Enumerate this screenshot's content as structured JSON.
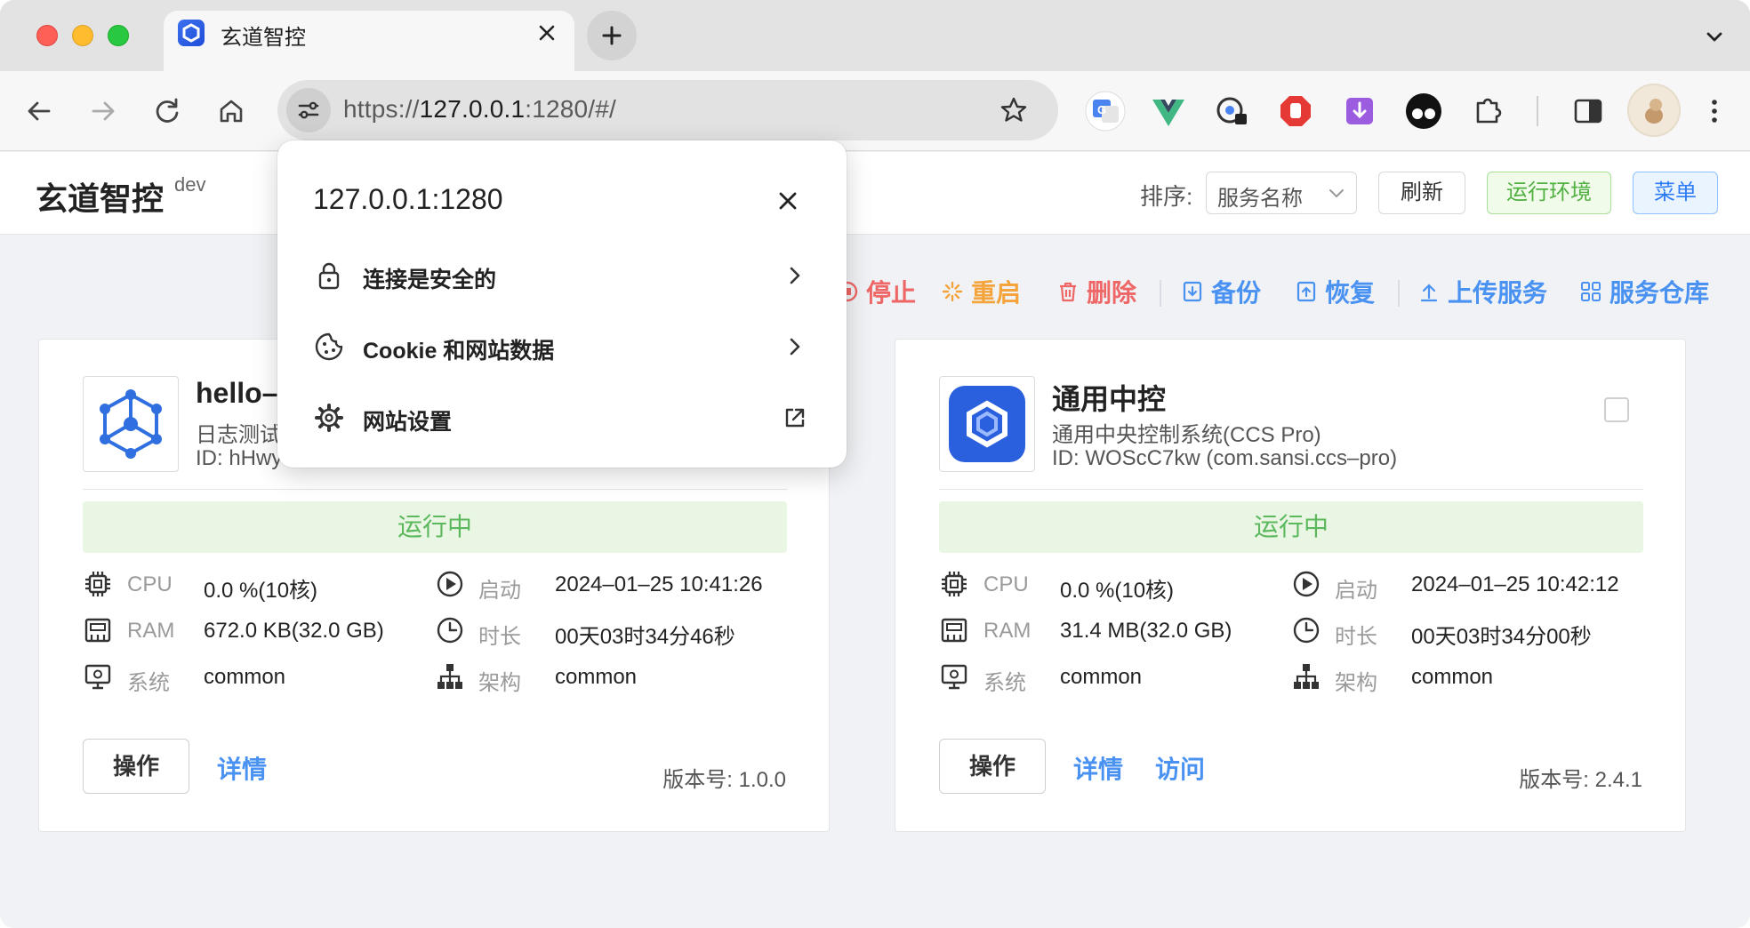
{
  "tab": {
    "title": "玄道智控"
  },
  "omnibox": {
    "url_scheme": "https://",
    "url_host": "127.0.0.1",
    "url_rest": ":1280/#/"
  },
  "popup": {
    "title": "127.0.0.1:1280",
    "items": [
      {
        "label": "连接是安全的",
        "icon": "lock-icon"
      },
      {
        "label": "Cookie 和网站数据",
        "icon": "cookie-icon"
      },
      {
        "label": "网站设置",
        "icon": "gear-icon"
      }
    ]
  },
  "header": {
    "title": "玄道智控",
    "env": "dev",
    "sort_label": "排序:",
    "sort_value": "服务名称",
    "refresh": "刷新",
    "run_env": "运行环境",
    "menu": "菜单"
  },
  "actions": {
    "stop": "停止",
    "restart": "重启",
    "delete": "删除",
    "backup": "备份",
    "restore": "恢复",
    "upload": "上传服务",
    "repo": "服务仓库"
  },
  "colors": {
    "danger": "#ee6666",
    "warning": "#f4a43b",
    "primary": "#4a92f2",
    "success": "#5cb85c"
  },
  "labels": {
    "cpu": "CPU",
    "ram": "RAM",
    "system": "系统",
    "start": "启动",
    "duration": "时长",
    "arch": "架构",
    "operate": "操作",
    "detail": "详情",
    "visit": "访问"
  },
  "services": [
    {
      "name": "hello–",
      "desc": "日志测试",
      "id": "ID: hHwy",
      "status": "运行中",
      "cpu": "0.0 %(10核)",
      "ram": "672.0 KB(32.0 GB)",
      "system": "common",
      "start": "2024–01–25 10:41:26",
      "duration": "00天03时34分46秒",
      "arch": "common",
      "version": "版本号: 1.0.0"
    },
    {
      "name": "通用中控",
      "desc": "通用中央控制系统(CCS Pro)",
      "id": "ID: WOScC7kw (com.sansi.ccs–pro)",
      "status": "运行中",
      "cpu": "0.0 %(10核)",
      "ram": "31.4 MB(32.0 GB)",
      "system": "common",
      "start": "2024–01–25 10:42:12",
      "duration": "00天03时34分00秒",
      "arch": "common",
      "version": "版本号: 2.4.1"
    }
  ]
}
